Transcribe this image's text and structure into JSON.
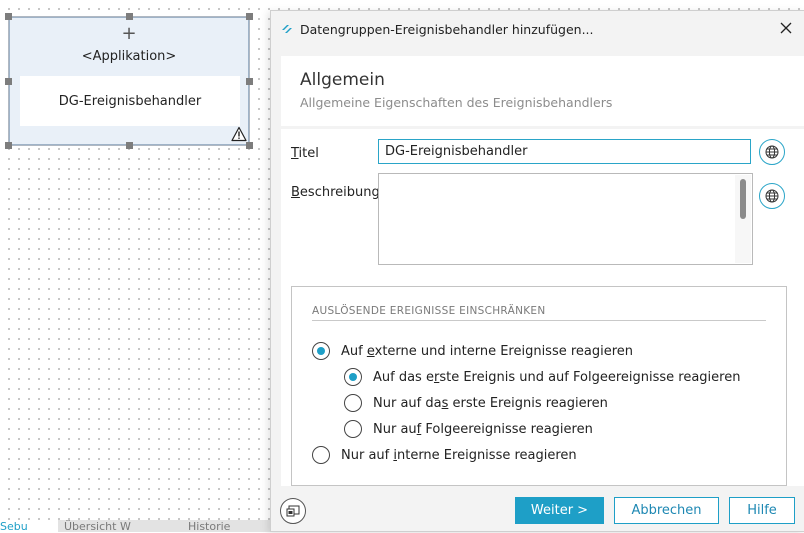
{
  "canvas": {
    "node": {
      "kind": "<Applikation>",
      "name": "DG-Ereignisbehandler"
    },
    "tabs": [
      "Sebu",
      "Übersicht W",
      "Historie"
    ]
  },
  "dialog": {
    "title": "Datengruppen-Ereignisbehandler hinzufügen...",
    "header": {
      "title": "Allgemein",
      "subtitle": "Allgemeine Eigenschaften des Ereignisbehandlers"
    },
    "form": {
      "title_label_u": "T",
      "title_label_rest": "itel",
      "title_value": "DG-Ereignisbehandler",
      "desc_label_u": "B",
      "desc_label_rest": "eschreibung",
      "desc_value": ""
    },
    "group": {
      "title": "AUSLÖSENDE EREIGNISSE EINSCHRÄNKEN",
      "options": [
        {
          "pre": "Auf ",
          "u": "e",
          "post": "xterne und interne Ereignisse reagieren",
          "checked": true
        },
        {
          "pre": "Auf das e",
          "u": "r",
          "post": "ste Ereignis und auf Folgeereignisse reagieren",
          "checked": true
        },
        {
          "pre": "Nur auf da",
          "u": "s",
          "post": " erste Ereignis reagieren",
          "checked": false
        },
        {
          "pre": "Nur au",
          "u": "f",
          "post": " Folgeereignisse reagieren",
          "checked": false
        },
        {
          "pre": "Nur auf ",
          "u": "i",
          "post": "nterne Ereignisse reagieren",
          "checked": false
        }
      ]
    },
    "buttons": {
      "next": "Weiter >",
      "cancel": "Abbrechen",
      "help": "Hilfe"
    }
  },
  "colors": {
    "accent": "#1e9fc7",
    "selection_fill": "#e9f0f8"
  },
  "icons": [
    "app-icon",
    "close-icon",
    "warning-icon",
    "globe-icon",
    "window-icon",
    "plus-icon"
  ]
}
